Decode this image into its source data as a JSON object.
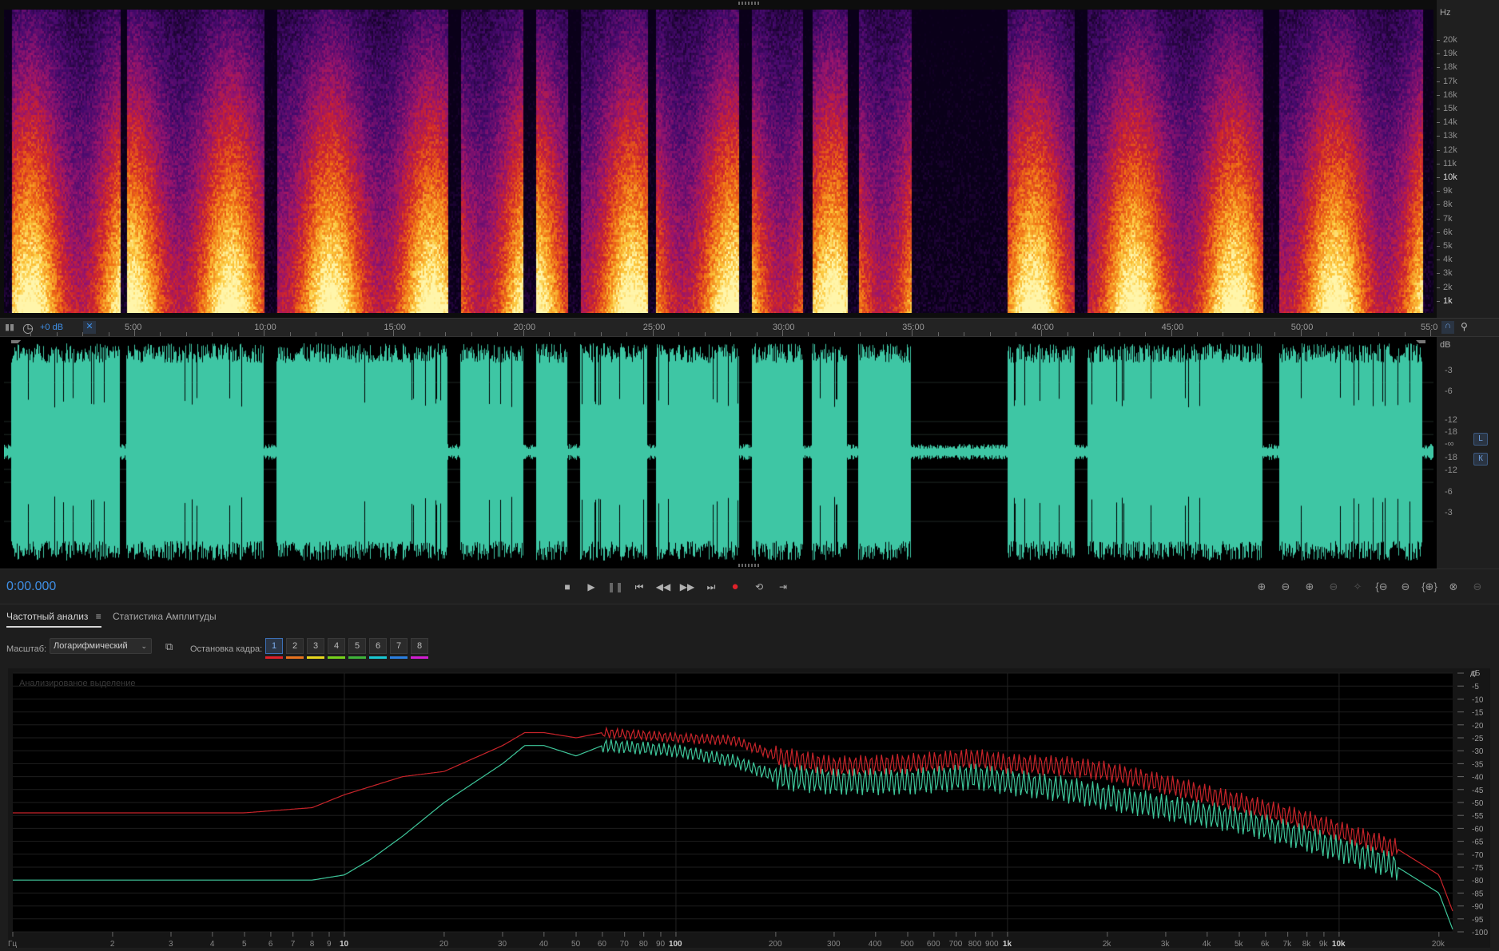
{
  "colors": {
    "accent": "#3f8fe6",
    "waveform": "#3ec6a4",
    "record": "#e0222a"
  },
  "spectral": {
    "hz_unit": "Hz",
    "hz_labels": [
      "20k",
      "19k",
      "18k",
      "17k",
      "16k",
      "15k",
      "14k",
      "13k",
      "12k",
      "11k",
      "10k",
      "9k",
      "8k",
      "7k",
      "6k",
      "5k",
      "4k",
      "3k",
      "2k",
      "1k"
    ]
  },
  "timeline": {
    "level_readout": "+0 dB",
    "ticks": [
      "5:00",
      "10:00",
      "15:00",
      "20:00",
      "25:00",
      "30:00",
      "35:00",
      "40:00",
      "45:00",
      "50:00",
      "55:0"
    ]
  },
  "waveform": {
    "db_unit": "dB",
    "db_labels": [
      "-3",
      "-6",
      "-12",
      "-18",
      "-∞",
      "-18",
      "-12",
      "-6",
      "-3"
    ],
    "channels": [
      "L",
      "К"
    ]
  },
  "transport": {
    "timecode": "0:00.000",
    "buttons": [
      "stop-icon",
      "play-icon",
      "pause-icon",
      "skip-start-icon",
      "rewind-icon",
      "fast-forward-icon",
      "skip-end-icon",
      "record-icon",
      "loop-icon",
      "skip-selection-icon"
    ],
    "zoom_buttons": [
      "zoom-in-amplitude-icon",
      "zoom-out-amplitude-icon",
      "zoom-in-time-icon",
      "zoom-out-time-icon",
      "zoom-full-icon",
      "zoom-in-left-icon",
      "zoom-in-right-icon",
      "zoom-selection-icon",
      "zoom-reset-icon",
      "zoom-out-full-icon"
    ]
  },
  "panel": {
    "tabs": [
      {
        "label": "Частотный анализ"
      },
      {
        "label": "Статистика Амплитуды"
      }
    ],
    "scale_label": "Масштаб:",
    "scale_value": "Логарифмический",
    "freeze_label": "Остановка кадра:",
    "freeze_holds": [
      "1",
      "2",
      "3",
      "4",
      "5",
      "6",
      "7",
      "8"
    ],
    "freeze_colors": [
      "#e0202a",
      "#e8731e",
      "#e8d81e",
      "#76d21c",
      "#3fb43a",
      "#19c8d2",
      "#2a7fe0",
      "#d21ed2"
    ]
  },
  "chart_data": {
    "type": "line",
    "title": "Анализированое выделение",
    "xlabel": "Гц",
    "ylabel": "дБ",
    "x_scale": "log",
    "xlim": [
      1,
      22000
    ],
    "ylim": [
      -100,
      0
    ],
    "x_ticks": [
      {
        "v": 1,
        "t": "Гц"
      },
      {
        "v": 2,
        "t": "2"
      },
      {
        "v": 3,
        "t": "3"
      },
      {
        "v": 4,
        "t": "4"
      },
      {
        "v": 5,
        "t": "5"
      },
      {
        "v": 6,
        "t": "6"
      },
      {
        "v": 7,
        "t": "7"
      },
      {
        "v": 8,
        "t": "8"
      },
      {
        "v": 9,
        "t": "9"
      },
      {
        "v": 10,
        "t": "10"
      },
      {
        "v": 20,
        "t": "20"
      },
      {
        "v": 30,
        "t": "30"
      },
      {
        "v": 40,
        "t": "40"
      },
      {
        "v": 50,
        "t": "50"
      },
      {
        "v": 60,
        "t": "60"
      },
      {
        "v": 70,
        "t": "70"
      },
      {
        "v": 80,
        "t": "80"
      },
      {
        "v": 90,
        "t": "90"
      },
      {
        "v": 100,
        "t": "100"
      },
      {
        "v": 200,
        "t": "200"
      },
      {
        "v": 300,
        "t": "300"
      },
      {
        "v": 400,
        "t": "400"
      },
      {
        "v": 500,
        "t": "500"
      },
      {
        "v": 600,
        "t": "600"
      },
      {
        "v": 700,
        "t": "700"
      },
      {
        "v": 800,
        "t": "800"
      },
      {
        "v": 900,
        "t": "900"
      },
      {
        "v": 1000,
        "t": "1k"
      },
      {
        "v": 2000,
        "t": "2k"
      },
      {
        "v": 3000,
        "t": "3k"
      },
      {
        "v": 4000,
        "t": "4k"
      },
      {
        "v": 5000,
        "t": "5k"
      },
      {
        "v": 6000,
        "t": "6k"
      },
      {
        "v": 7000,
        "t": "7k"
      },
      {
        "v": 8000,
        "t": "8k"
      },
      {
        "v": 9000,
        "t": "9k"
      },
      {
        "v": 10000,
        "t": "10k"
      },
      {
        "v": 20000,
        "t": "20k"
      }
    ],
    "y_ticks": [
      "0",
      "-5",
      "-10",
      "-15",
      "-20",
      "-25",
      "-30",
      "-35",
      "-40",
      "-45",
      "-50",
      "-55",
      "-60",
      "-65",
      "-70",
      "-75",
      "-80",
      "-85",
      "-90",
      "-95",
      "-100"
    ],
    "series": [
      {
        "color": "#c8242a",
        "points": [
          [
            1,
            -54
          ],
          [
            5,
            -54
          ],
          [
            8,
            -52
          ],
          [
            10,
            -47
          ],
          [
            15,
            -40
          ],
          [
            20,
            -38
          ],
          [
            30,
            -28
          ],
          [
            35,
            -23
          ],
          [
            40,
            -23
          ],
          [
            50,
            -25
          ],
          [
            60,
            -23
          ],
          [
            80,
            -24
          ],
          [
            100,
            -25
          ],
          [
            150,
            -26
          ],
          [
            200,
            -32
          ],
          [
            300,
            -36
          ],
          [
            500,
            -35
          ],
          [
            800,
            -33
          ],
          [
            1000,
            -35
          ],
          [
            1500,
            -36
          ],
          [
            2000,
            -38
          ],
          [
            3000,
            -43
          ],
          [
            5000,
            -50
          ],
          [
            8000,
            -57
          ],
          [
            10000,
            -61
          ],
          [
            15000,
            -68
          ],
          [
            20000,
            -78
          ],
          [
            22000,
            -92
          ]
        ]
      },
      {
        "color": "#3ec69a",
        "points": [
          [
            1,
            -80
          ],
          [
            8,
            -80
          ],
          [
            10,
            -78
          ],
          [
            12,
            -72
          ],
          [
            15,
            -63
          ],
          [
            20,
            -50
          ],
          [
            30,
            -35
          ],
          [
            35,
            -28
          ],
          [
            40,
            -28
          ],
          [
            50,
            -32
          ],
          [
            60,
            -28
          ],
          [
            80,
            -29
          ],
          [
            100,
            -30
          ],
          [
            150,
            -34
          ],
          [
            200,
            -40
          ],
          [
            300,
            -42
          ],
          [
            500,
            -42
          ],
          [
            800,
            -40
          ],
          [
            1000,
            -42
          ],
          [
            1500,
            -45
          ],
          [
            2000,
            -48
          ],
          [
            3000,
            -52
          ],
          [
            5000,
            -57
          ],
          [
            8000,
            -64
          ],
          [
            10000,
            -68
          ],
          [
            15000,
            -75
          ],
          [
            20000,
            -85
          ],
          [
            22000,
            -99
          ]
        ]
      }
    ]
  }
}
